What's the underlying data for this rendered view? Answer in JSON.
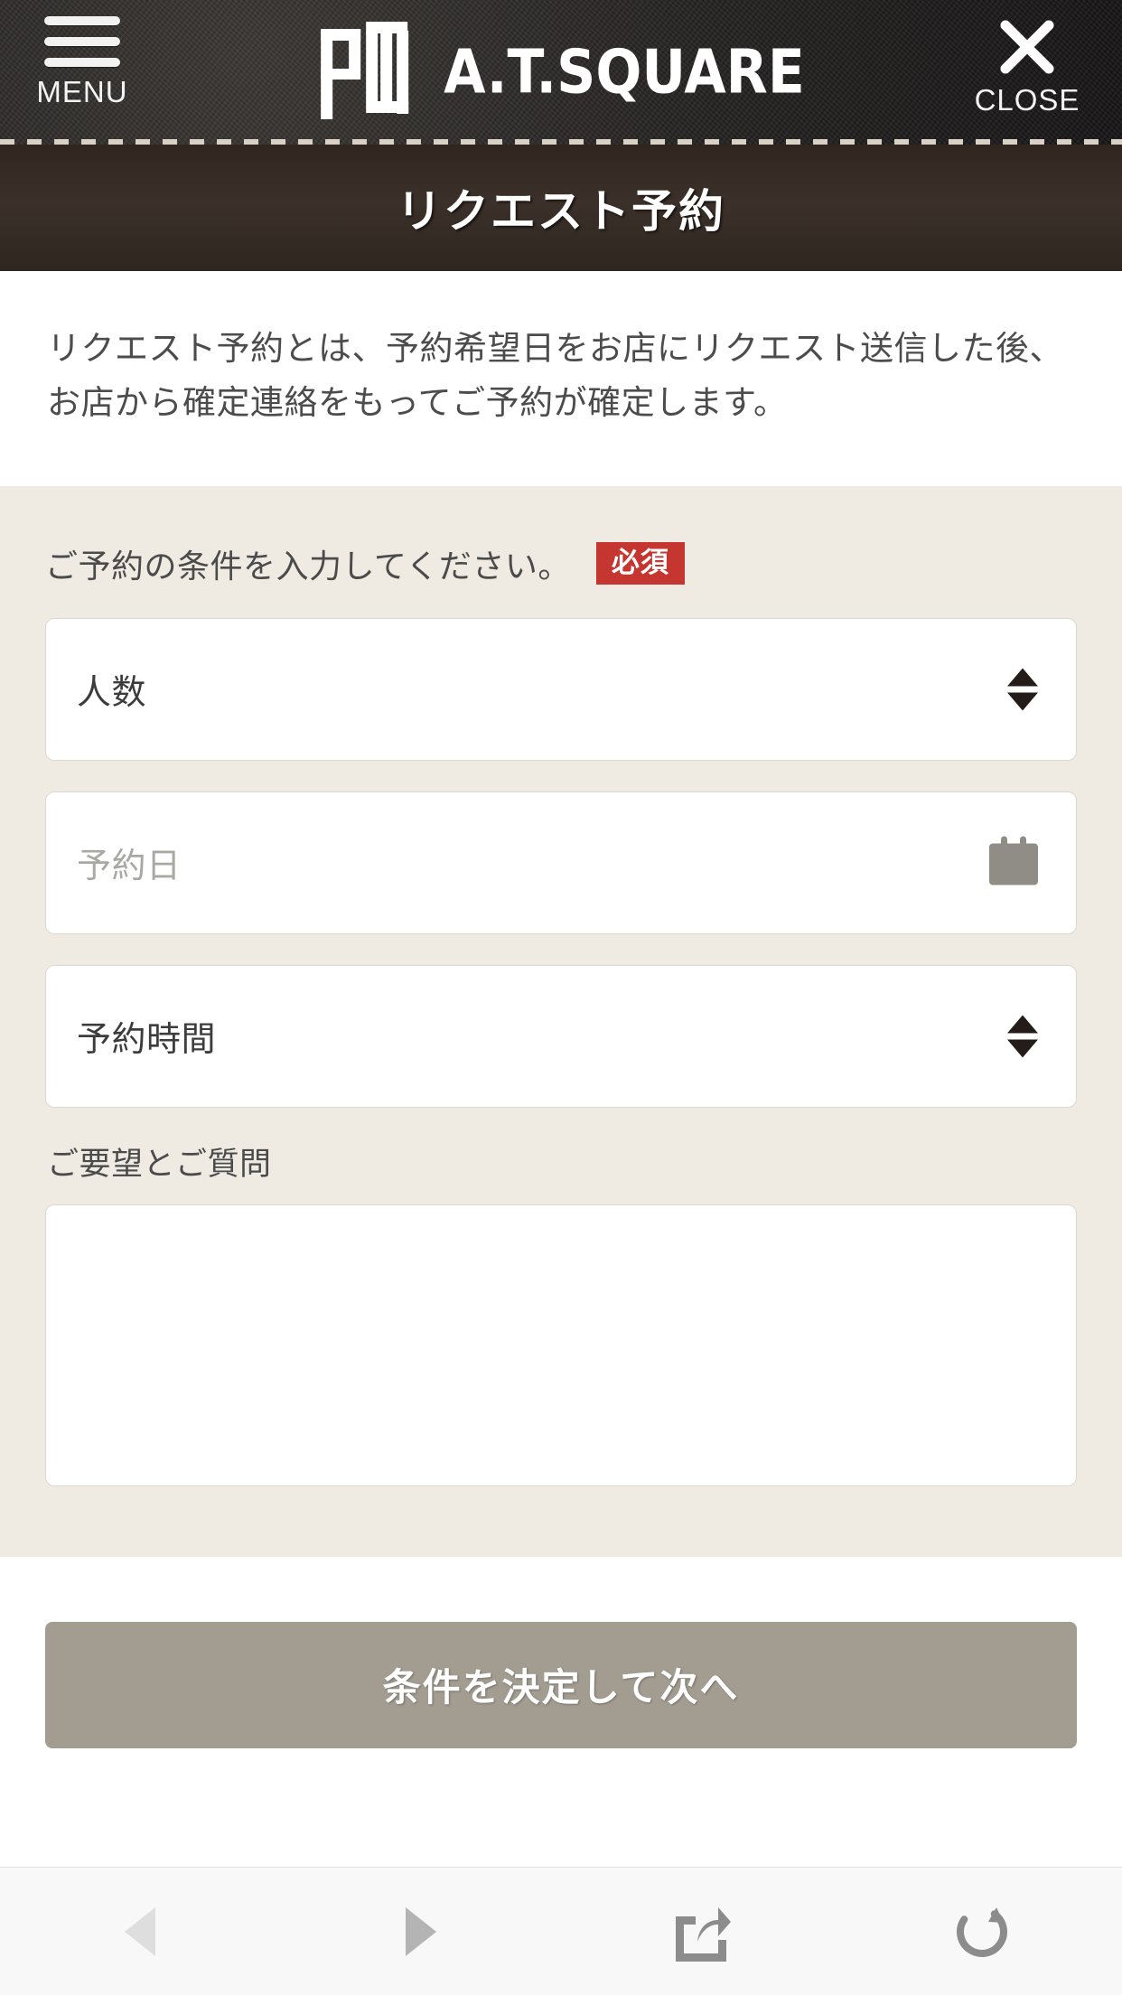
{
  "header": {
    "menu_label": "MENU",
    "close_label": "CLOSE",
    "brand_text": "A.T.SQUARE",
    "brand_mark_name": "at-monogram-logo"
  },
  "page": {
    "title": "リクエスト予約",
    "intro": "リクエスト予約とは、予約希望日をお店にリクエスト送信した後、お店から確定連絡をもってご予約が確定します。"
  },
  "form": {
    "section_label": "ご予約の条件を入力してください。",
    "required_badge": "必須",
    "fields": [
      {
        "name": "party-size-select",
        "value": "人数",
        "is_placeholder": false,
        "control": "stepper"
      },
      {
        "name": "reservation-date-input",
        "value": "予約日",
        "is_placeholder": true,
        "control": "calendar"
      },
      {
        "name": "reservation-time-select",
        "value": "予約時間",
        "is_placeholder": false,
        "control": "stepper"
      }
    ],
    "textarea_label": "ご要望とご質問",
    "textarea_value": ""
  },
  "submit": {
    "label": "条件を決定して次へ"
  },
  "toolbar": {
    "items": [
      {
        "name": "back-button",
        "icon": "back-triangle-icon",
        "enabled": false
      },
      {
        "name": "forward-button",
        "icon": "forward-triangle-icon",
        "enabled": true
      },
      {
        "name": "share-button",
        "icon": "share-icon",
        "enabled": true
      },
      {
        "name": "reload-button",
        "icon": "reload-icon",
        "enabled": true
      }
    ]
  },
  "colors": {
    "header_dark": "#232020",
    "title_band": "#3b302a",
    "form_bg": "#efebe3",
    "required_red": "#c4362f",
    "submit_gray": "#a29c91",
    "placeholder_gray": "#a9a9a4",
    "toolbar_bg": "#f8f8f8"
  }
}
